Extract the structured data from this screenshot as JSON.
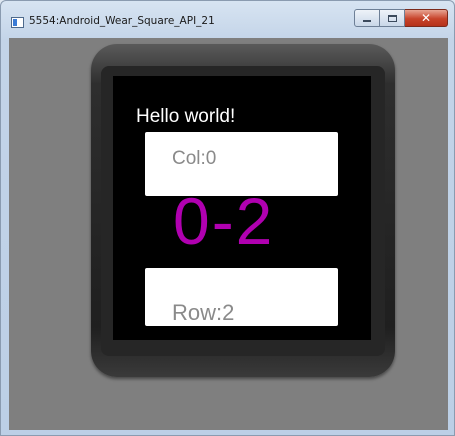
{
  "window": {
    "title": "5554:Android_Wear_Square_API_21",
    "controls": {
      "minimize_icon": "minimize-icon",
      "maximize_icon": "maximize-icon",
      "close_icon": "close-icon",
      "close_glyph": "✕"
    }
  },
  "watch": {
    "hello_text": "Hello world!",
    "grid_position_label": "0-2",
    "cards": {
      "column_text": "Col:0",
      "row_text": "Row:2"
    }
  },
  "colors": {
    "screen_background": "#000000",
    "emulator_background": "#7f7f7f",
    "position_label": "#b000b0",
    "card_background": "#ffffff",
    "card_text": "#8a8a8a",
    "close_button": "#c7432a"
  }
}
